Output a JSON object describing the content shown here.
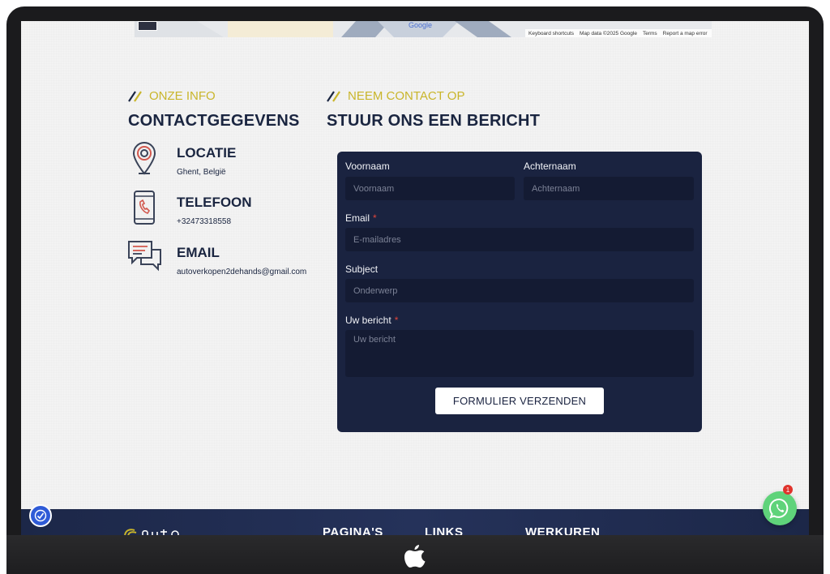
{
  "map": {
    "google_label": "Google",
    "attribution": [
      "Keyboard shortcuts",
      "Map data ©2025 Google",
      "Terms",
      "Report a map error"
    ]
  },
  "info_section": {
    "eyebrow": "ONZE INFO",
    "title": "CONTACTGEGEVENS",
    "items": [
      {
        "title": "LOCATIE",
        "value": "Ghent, België",
        "icon": "location-pin-icon"
      },
      {
        "title": "TELEFOON",
        "value": "+32473318558",
        "icon": "phone-icon"
      },
      {
        "title": "EMAIL",
        "value": "autoverkopen2dehands@gmail.com",
        "icon": "chat-icon"
      }
    ]
  },
  "form_section": {
    "eyebrow": "NEEM CONTACT OP",
    "title": "STUUR ONS EEN BERICHT",
    "fields": {
      "first_name": {
        "label": "Voornaam",
        "placeholder": "Voornaam"
      },
      "last_name": {
        "label": "Achternaam",
        "placeholder": "Achternaam"
      },
      "email": {
        "label": "Email",
        "placeholder": "E-mailadres",
        "required": "*"
      },
      "subject": {
        "label": "Subject",
        "placeholder": "Onderwerp"
      },
      "message": {
        "label": "Uw bericht",
        "placeholder": "Uw bericht",
        "required": "*"
      }
    },
    "submit_label": "FORMULIER VERZENDEN"
  },
  "footer": {
    "headings": [
      "PAGINA'S",
      "LINKS",
      "WERKUREN"
    ]
  },
  "whatsapp": {
    "badge_count": "1"
  },
  "colors": {
    "accent": "#c9b52a",
    "navy": "#1a2540",
    "form_bg": "#1a2340",
    "required": "#e0453a",
    "whatsapp": "#5fd37a"
  }
}
